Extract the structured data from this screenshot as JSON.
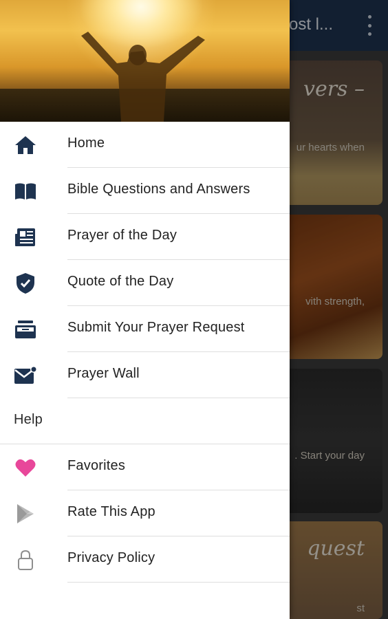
{
  "app": {
    "title": "ost l...",
    "cards": [
      {
        "headline": "vers –",
        "snippet": "ur hearts when"
      },
      {
        "headline": "",
        "snippet": "vith strength,"
      },
      {
        "headline": "",
        "snippet": ". Start your day"
      },
      {
        "headline": "quest",
        "snippet": "st"
      }
    ]
  },
  "drawer": {
    "items": [
      {
        "icon": "home-icon",
        "label": "Home"
      },
      {
        "icon": "book-icon",
        "label": "Bible Questions and Answers"
      },
      {
        "icon": "newspaper-icon",
        "label": "Prayer of the Day"
      },
      {
        "icon": "shield-check-icon",
        "label": "Quote of the Day"
      },
      {
        "icon": "inbox-icon",
        "label": "Submit Your Prayer Request"
      },
      {
        "icon": "mail-notification-icon",
        "label": "Prayer Wall"
      }
    ],
    "help_section": "Help",
    "help_items": [
      {
        "icon": "heart-icon",
        "label": "Favorites"
      },
      {
        "icon": "play-store-icon",
        "label": "Rate This App"
      },
      {
        "icon": "lock-icon",
        "label": "Privacy Policy"
      }
    ]
  },
  "colors": {
    "icon_navy": "#1e3350",
    "heart_pink": "#e8479a",
    "muted_gray": "#9a9a9a"
  }
}
